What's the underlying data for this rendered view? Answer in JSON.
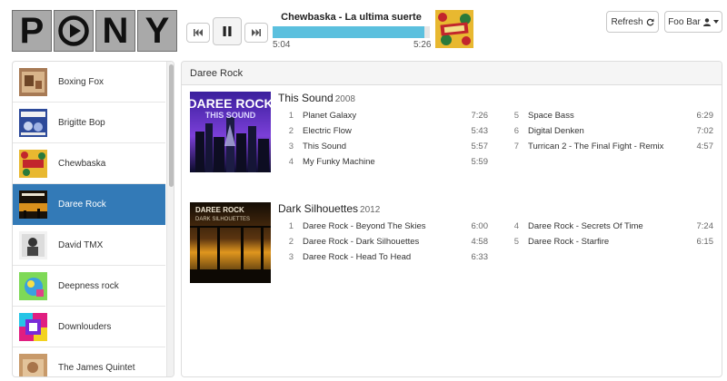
{
  "logo": {
    "letters": [
      "P",
      "O",
      "N",
      "Y"
    ],
    "icon": "play-circle-icon"
  },
  "player": {
    "prev_icon": "skip-back-icon",
    "pause_icon": "pause-icon",
    "next_icon": "skip-forward-icon",
    "now_playing": "Chewbaska - La ultima suerte",
    "current_time": "5:04",
    "total_time": "5:26",
    "progress_fraction": 0.965
  },
  "header_buttons": {
    "refresh_label": "Refresh",
    "refresh_icon": "refresh-icon",
    "user_label": "Foo Bar",
    "user_icon": "user-icon",
    "caret_icon": "caret-down-icon"
  },
  "colors": {
    "accent": "#337ab7",
    "progress": "#5bc0de"
  },
  "artists": [
    {
      "label": "Boxing Fox",
      "active": false
    },
    {
      "label": "Brigitte Bop",
      "active": false
    },
    {
      "label": "Chewbaska",
      "active": false
    },
    {
      "label": "Daree Rock",
      "active": true
    },
    {
      "label": "David TMX",
      "active": false
    },
    {
      "label": "Deepness rock",
      "active": false
    },
    {
      "label": "Downlouders",
      "active": false
    },
    {
      "label": "The James Quintet",
      "active": false
    }
  ],
  "main": {
    "artist_heading": "Daree Rock",
    "albums": [
      {
        "title": "This Sound",
        "year": "2008",
        "cover_text": [
          "DAREE ROCK",
          "THIS SOUND"
        ],
        "tracks_left": [
          {
            "num": "1",
            "name": "Planet Galaxy",
            "dur": "7:26"
          },
          {
            "num": "2",
            "name": "Electric Flow",
            "dur": "5:43"
          },
          {
            "num": "3",
            "name": "This Sound",
            "dur": "5:57"
          },
          {
            "num": "4",
            "name": "My Funky Machine",
            "dur": "5:59"
          }
        ],
        "tracks_right": [
          {
            "num": "5",
            "name": "Space Bass",
            "dur": "6:29"
          },
          {
            "num": "6",
            "name": "Digital Denken",
            "dur": "7:02"
          },
          {
            "num": "7",
            "name": "Turrican 2 - The Final Fight - Remix",
            "dur": "4:57"
          }
        ]
      },
      {
        "title": "Dark Silhouettes",
        "year": "2012",
        "cover_text": [
          "DAREE ROCK",
          "DARK SILHOUETTES"
        ],
        "tracks_left": [
          {
            "num": "1",
            "name": "Daree Rock - Beyond The Skies",
            "dur": "6:00"
          },
          {
            "num": "2",
            "name": "Daree Rock - Dark Silhouettes",
            "dur": "4:58"
          },
          {
            "num": "3",
            "name": "Daree Rock - Head To Head",
            "dur": "6:33"
          }
        ],
        "tracks_right": [
          {
            "num": "4",
            "name": "Daree Rock - Secrets Of Time",
            "dur": "7:24"
          },
          {
            "num": "5",
            "name": "Daree Rock - Starfire",
            "dur": "6:15"
          }
        ]
      }
    ]
  }
}
